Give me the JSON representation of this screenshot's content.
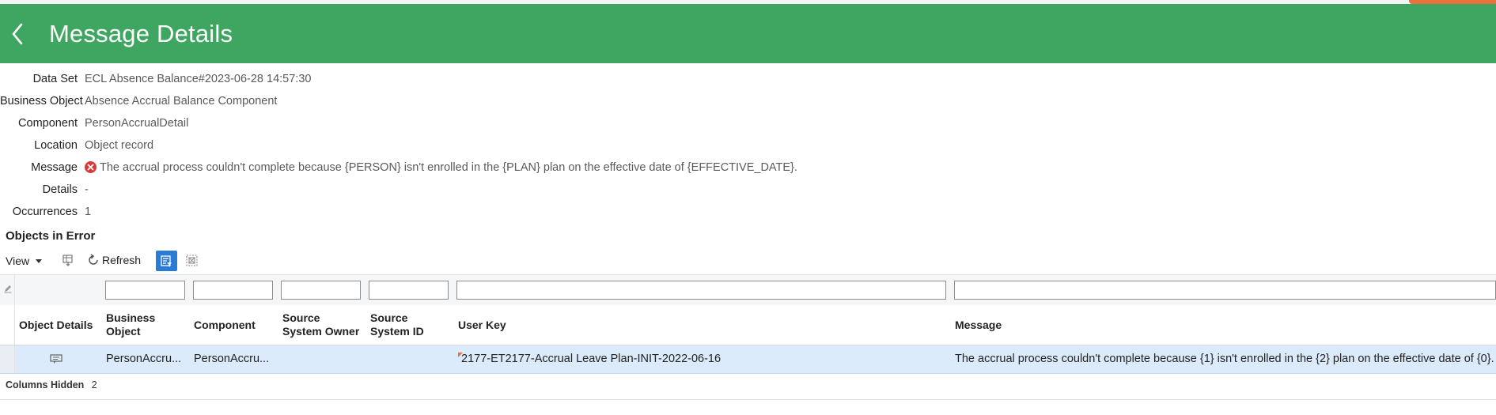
{
  "page": {
    "title": "Message Details"
  },
  "details": [
    {
      "label": "Data Set",
      "value": "ECL Absence Balance#2023-06-28 14:57:30"
    },
    {
      "label": "Business Object",
      "value": "Absence Accrual Balance Component"
    },
    {
      "label": "Component",
      "value": "PersonAccrualDetail"
    },
    {
      "label": "Location",
      "value": "Object record"
    },
    {
      "label": "Message",
      "value": "The accrual process couldn't complete because {PERSON} isn't enrolled in the {PLAN} plan on the effective date of {EFFECTIVE_DATE}."
    },
    {
      "label": "Details",
      "value": "-"
    },
    {
      "label": "Occurrences",
      "value": "1"
    }
  ],
  "section": {
    "title": "Objects in Error"
  },
  "toolbar": {
    "view_label": "View",
    "refresh_label": "Refresh"
  },
  "table": {
    "headers": {
      "object_details": "Object Details",
      "business_object_1": "Business",
      "business_object_2": "Object",
      "component": "Component",
      "source_owner_1": "Source",
      "source_owner_2": "System Owner",
      "source_id_1": "Source",
      "source_id_2": "System ID",
      "user_key": "User Key",
      "message": "Message"
    },
    "rows": [
      {
        "business_object": "PersonAccru...",
        "component": "PersonAccru...",
        "source_owner": "",
        "source_id": "",
        "user_key": "2177-ET2177-Accrual Leave Plan-INIT-2022-06-16",
        "message": "The accrual process couldn't complete because {1} isn't enrolled in the {2} plan on the effective date of {0}."
      }
    ]
  },
  "footer": {
    "columns_hidden_label": "Columns Hidden",
    "columns_hidden_value": "2"
  },
  "colors": {
    "header_bg": "#3ea660",
    "selected_row_bg": "#dcebfb",
    "active_toolbar_button": "#2a7bd6",
    "error_icon": "#d63b3b"
  },
  "icons": {
    "back": "chevron-left-icon",
    "error": "error-circle-icon",
    "detach": "detach-table-icon",
    "refresh": "refresh-icon",
    "query_by_example": "query-by-example-icon",
    "freeze": "freeze-columns-icon",
    "edit": "pencil-icon",
    "object_details": "object-details-icon"
  }
}
